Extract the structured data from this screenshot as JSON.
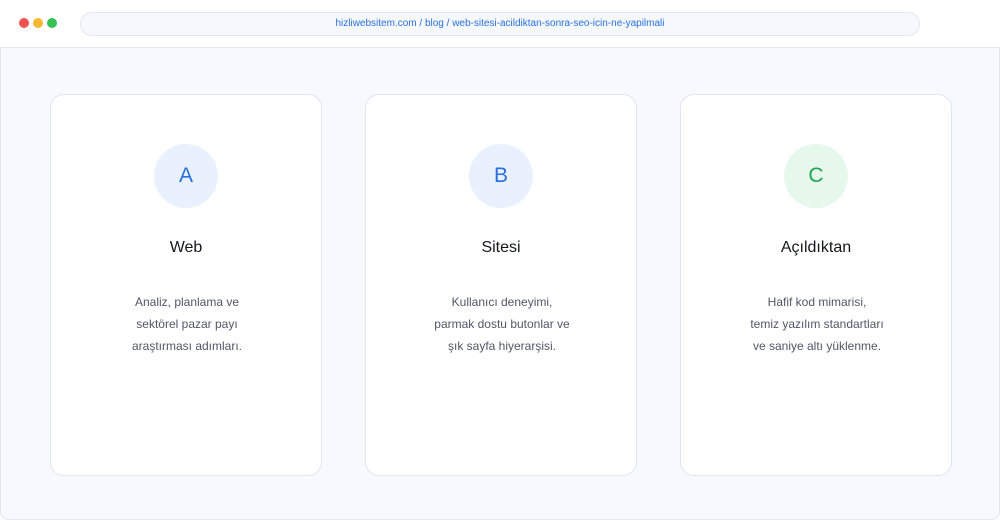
{
  "browser": {
    "url": "hizliwebsitem.com / blog / web-sitesi-acildiktan-sonra-seo-icin-ne-yapilmali"
  },
  "cards": [
    {
      "badge": "A",
      "badge_bg": "#e8f1fd",
      "badge_color": "#2a6fdb",
      "title": "Web",
      "desc_lines": [
        "Analiz, planlama ve",
        "sektörel pazar payı",
        "araştırması adımları."
      ]
    },
    {
      "badge": "B",
      "badge_bg": "#e8f1fd",
      "badge_color": "#2a6fdb",
      "title": "Sitesi",
      "desc_lines": [
        "Kullanıcı deneyimi,",
        "parmak dostu butonlar ve",
        "şık sayfa hiyerarşisi."
      ]
    },
    {
      "badge": "C",
      "badge_bg": "#e6f7ec",
      "badge_color": "#1fa64f",
      "title": "Açıldıktan",
      "desc_lines": [
        "Hafif kod mimarisi,",
        "temiz yazılım standartları",
        "ve saniye altı yüklenme."
      ]
    }
  ]
}
